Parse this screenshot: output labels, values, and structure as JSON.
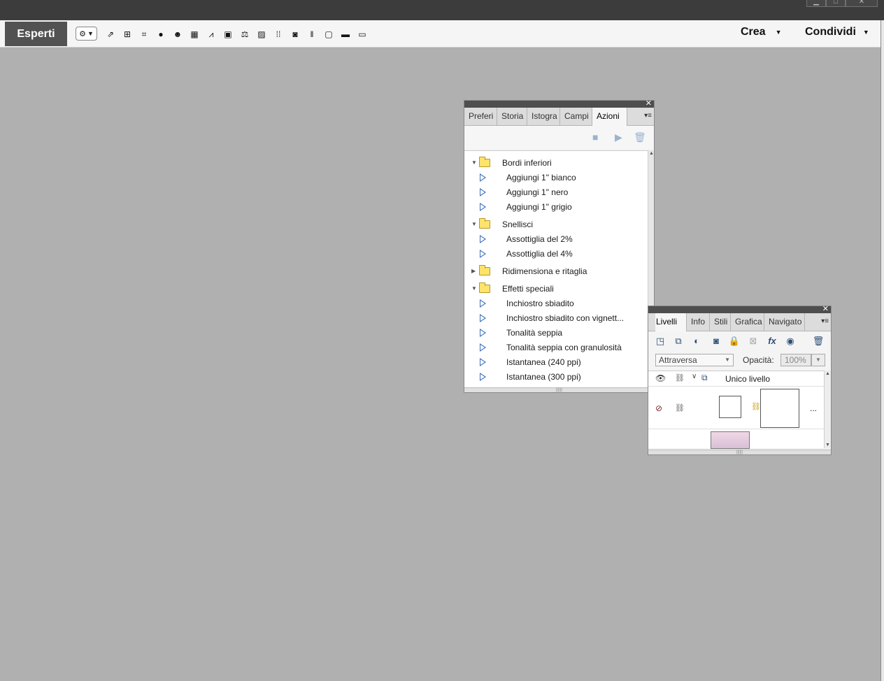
{
  "window": {
    "controls": [
      "minimize",
      "restore",
      "close"
    ]
  },
  "toolbar": {
    "mode_label": "Esperti",
    "settings_icon": "gear-icon",
    "icons": [
      "external-link-icon",
      "presentation-icon",
      "crop-icon",
      "person-icon",
      "smiley-icon",
      "grid-icon",
      "chart-icon",
      "h-box-icon",
      "balance-icon",
      "image-icon",
      "dotted-grid-icon",
      "camera-icon",
      "pause-bars-icon",
      "frame-icon",
      "laptop-icon",
      "monitor-icon"
    ],
    "create_label": "Crea",
    "share_label": "Condividi"
  },
  "actions_panel": {
    "tabs": [
      "Preferi",
      "Storia",
      "Istogra",
      "Campi",
      "Azioni"
    ],
    "active_tab": "Azioni",
    "groups": [
      {
        "name": "Bordi inferiori",
        "expanded": true,
        "items": [
          "Aggiungi 1\" bianco",
          "Aggiungi 1\" nero",
          "Aggiungi 1\" grigio"
        ]
      },
      {
        "name": "Snellisci",
        "expanded": true,
        "items": [
          "Assottiglia del 2%",
          "Assottiglia del 4%"
        ]
      },
      {
        "name": "Ridimensiona e ritaglia",
        "expanded": false,
        "items": []
      },
      {
        "name": "Effetti speciali",
        "expanded": true,
        "items": [
          "Inchiostro sbiadito",
          "Inchiostro sbiadito con vignett...",
          "Tonalità seppia",
          "Tonalità seppia con granulosità",
          "Istantanea (240 ppi)",
          "Istantanea (300 ppi)"
        ]
      }
    ]
  },
  "layers_panel": {
    "tabs": [
      "Livelli",
      "Info",
      "Stili",
      "Grafica",
      "Navigato"
    ],
    "active_tab": "Livelli",
    "blend_mode": "Attraversa",
    "opacity_label": "Opacità:",
    "opacity_value": "100%",
    "group_name": "Unico livello",
    "more_label": "..."
  }
}
